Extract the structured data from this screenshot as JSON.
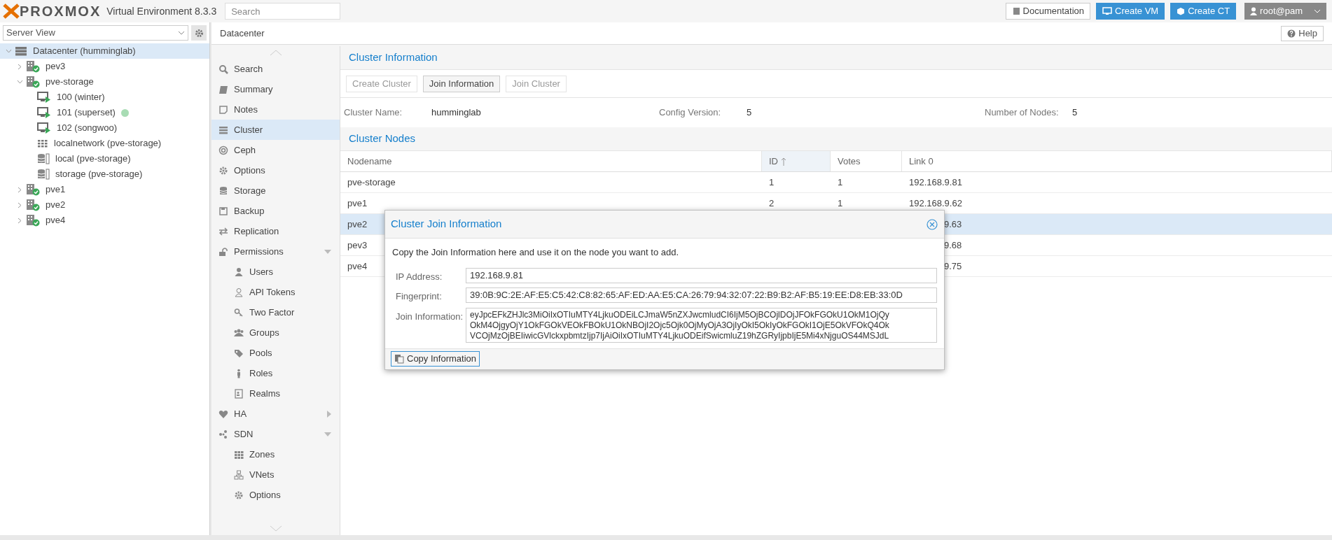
{
  "topbar": {
    "logo": "PROXMOX",
    "product": "Virtual Environment 8.3.3",
    "search": {
      "placeholder": "Search"
    },
    "buttons": [
      {
        "label": "Documentation",
        "kind": "plain"
      },
      {
        "label": "Create VM",
        "kind": "primary"
      },
      {
        "label": "Create CT",
        "kind": "primary"
      }
    ],
    "user": "root@pam"
  },
  "sidebar": {
    "view": "Server View",
    "tree": [
      {
        "label": "Datacenter (humminglab)",
        "kind": "datacenter",
        "expanded": true,
        "selected": true,
        "children": [
          {
            "label": "pev3",
            "kind": "node",
            "expanded": false,
            "selected": false
          },
          {
            "label": "pve-storage",
            "kind": "node",
            "expanded": true,
            "selected": false,
            "children": [
              {
                "label": "100 (winter)",
                "kind": "vm",
                "selected": false
              },
              {
                "label": "101 (superset)",
                "kind": "vm",
                "selected": false,
                "color": "#a8dcb4"
              },
              {
                "label": "102 (songwoo)",
                "kind": "vm",
                "selected": false
              },
              {
                "label": "localnetwork (pve-storage)",
                "kind": "sdn",
                "selected": false
              },
              {
                "label": "local (pve-storage)",
                "kind": "storage",
                "selected": false
              },
              {
                "label": "storage (pve-storage)",
                "kind": "storage",
                "selected": false
              }
            ]
          },
          {
            "label": "pve1",
            "kind": "node",
            "expanded": false,
            "selected": false
          },
          {
            "label": "pve2",
            "kind": "node",
            "expanded": false,
            "selected": false
          },
          {
            "label": "pve4",
            "kind": "node",
            "expanded": false,
            "selected": false
          }
        ]
      }
    ]
  },
  "content": {
    "title": "Datacenter",
    "help": "Help"
  },
  "nav": [
    {
      "label": "Search",
      "selected": false
    },
    {
      "label": "Summary",
      "selected": false
    },
    {
      "label": "Notes",
      "selected": false
    },
    {
      "label": "Cluster",
      "selected": true
    },
    {
      "label": "Ceph",
      "selected": false
    },
    {
      "label": "Options",
      "selected": false
    },
    {
      "label": "Storage",
      "selected": false
    },
    {
      "label": "Backup",
      "selected": false
    },
    {
      "label": "Replication",
      "selected": false
    },
    {
      "label": "Permissions",
      "selected": false,
      "expanded": true,
      "children": [
        {
          "label": "Users",
          "selected": false
        },
        {
          "label": "API Tokens",
          "selected": false
        },
        {
          "label": "Two Factor",
          "selected": false
        },
        {
          "label": "Groups",
          "selected": false
        },
        {
          "label": "Pools",
          "selected": false
        },
        {
          "label": "Roles",
          "selected": false
        },
        {
          "label": "Realms",
          "selected": false
        }
      ]
    },
    {
      "label": "HA",
      "selected": false,
      "expanded": false
    },
    {
      "label": "SDN",
      "selected": false,
      "expanded": true,
      "children": [
        {
          "label": "Zones",
          "selected": false
        },
        {
          "label": "VNets",
          "selected": false
        },
        {
          "label": "Options",
          "selected": false
        }
      ]
    }
  ],
  "cluster_info": {
    "title": "Cluster Information",
    "buttons": [
      {
        "label": "Create Cluster",
        "disabled": true
      },
      {
        "label": "Join Information",
        "disabled": false
      },
      {
        "label": "Join Cluster",
        "disabled": true
      }
    ],
    "fields": [
      {
        "label": "Cluster Name:",
        "value": "humminglab"
      },
      {
        "label": "Config Version:",
        "value": "5"
      },
      {
        "label": "Number of Nodes:",
        "value": "5"
      }
    ]
  },
  "cluster_nodes": {
    "title": "Cluster Nodes",
    "columns": [
      {
        "label": "Nodename",
        "sorted": false
      },
      {
        "label": "ID",
        "sorted": true
      },
      {
        "label": "Votes",
        "sorted": false
      },
      {
        "label": "Link 0",
        "sorted": false
      }
    ],
    "rows": [
      {
        "cells": [
          "pve-storage",
          "1",
          "1",
          "192.168.9.81"
        ],
        "selected": false,
        "covered": false
      },
      {
        "cells": [
          "pve1",
          "2",
          "1",
          "192.168.9.62"
        ],
        "selected": false,
        "covered": false
      },
      {
        "cells": [
          "pve2",
          "",
          "",
          "9.63"
        ],
        "selected": true,
        "covered": true
      },
      {
        "cells": [
          "pev3",
          "",
          "",
          "9.68"
        ],
        "selected": false,
        "covered": true
      },
      {
        "cells": [
          "pve4",
          "",
          "",
          "9.75"
        ],
        "selected": false,
        "covered": true
      }
    ]
  },
  "dialog": {
    "title": "Cluster Join Information",
    "intro": "Copy the Join Information here and use it on the node you want to add.",
    "fields": [
      {
        "label": "IP Address:",
        "value": "192.168.9.81",
        "kind": "line"
      },
      {
        "label": "Fingerprint:",
        "value": "39:0B:9C:2E:AF:E5:C5:42:C8:82:65:AF:ED:AA:E5:CA:26:79:94:32:07:22:B9:B2:AF:B5:19:EE:D8:EB:33:0D",
        "kind": "line"
      },
      {
        "label": "Join Information:",
        "value": "eyJpcEFkZHJlc3MiOiIxOTIuMTY4LjkuODEiLCJmaW5nZXJwcmludCI6IjM5OjBCOjlDOjJFOkFGOkU1OkM1OjQy\nOkM4OjgyOjY1OkFGOkVEOkFBOkU1OkNBOjI2Ojc5Ojk0OjMyOjA3OjIyOkI5OkIyOkFGOkI1OjE5OkVFOkQ4Ok\nVCOjMzOjBEIiwicGVlckxpbmtzIjp7IjAiOiIxOTIuMTY4LjkuODEifSwicmluZ19hZGRyIjpbIjE5Mi4xNjguOS44MSJdL",
        "kind": "area"
      }
    ],
    "button": "Copy Information"
  }
}
